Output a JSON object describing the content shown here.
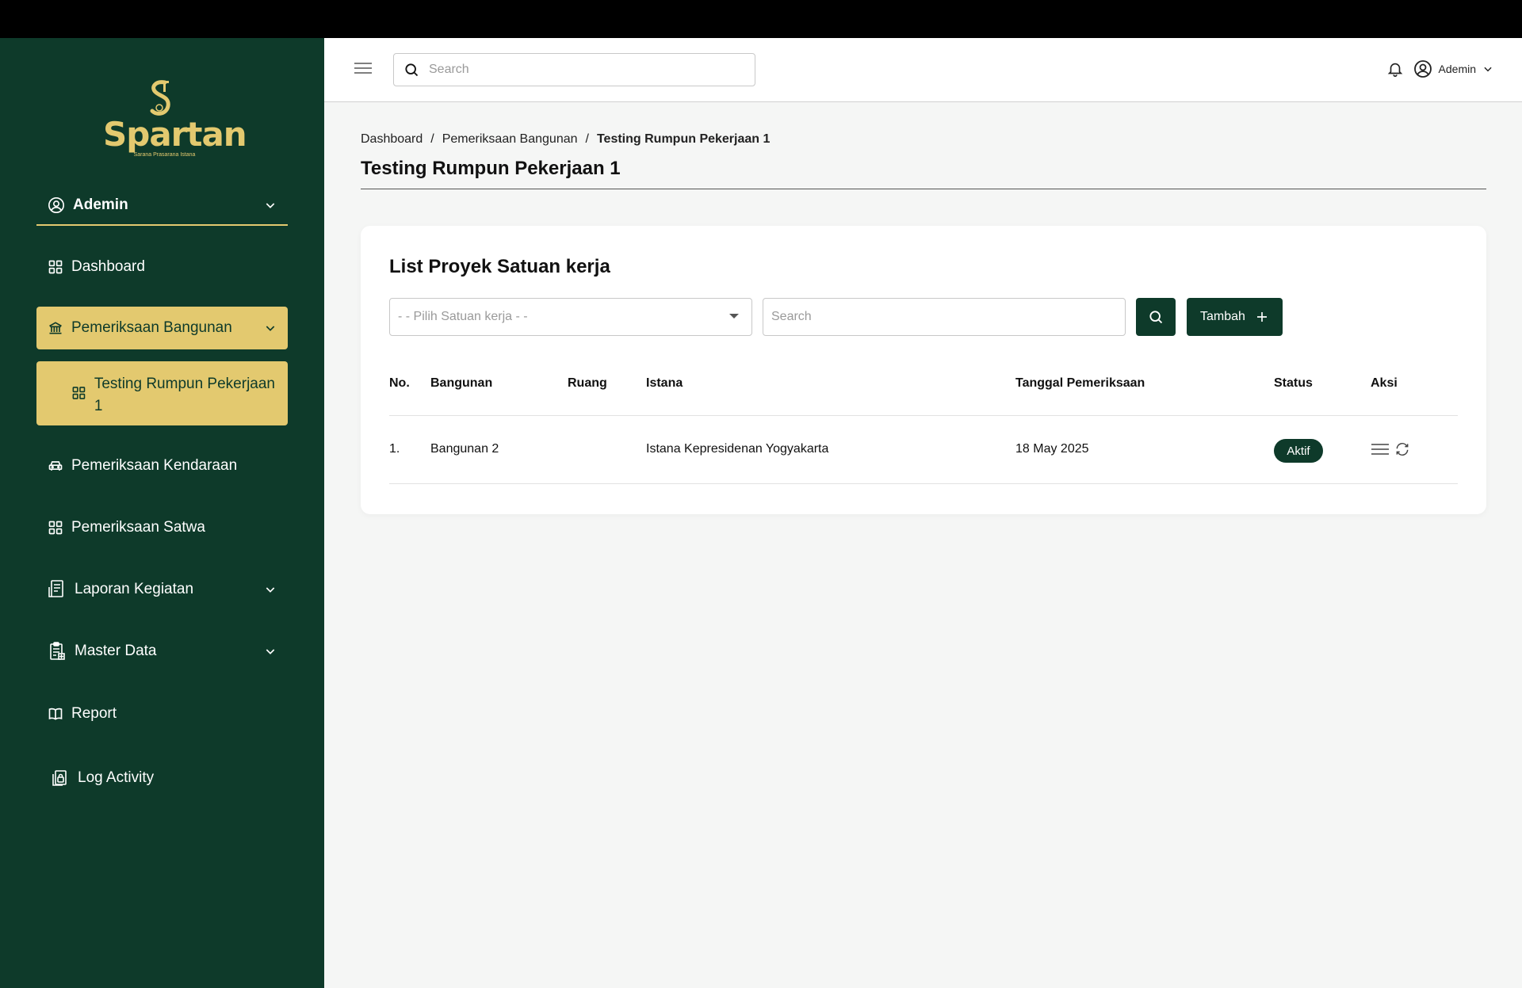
{
  "app": {
    "brand": "Spartan",
    "brand_sub": "Sarana Prasarana Istana"
  },
  "sidebar": {
    "user": "Ademin",
    "items": [
      {
        "label": "Dashboard",
        "icon": "grid-icon"
      },
      {
        "label": "Pemeriksaan Bangunan",
        "icon": "bank-icon",
        "active": true
      },
      {
        "label": "Testing Rumpun Pekerjaan 1",
        "icon": "grid-icon",
        "sub": true
      },
      {
        "label": "Pemeriksaan Kendaraan",
        "icon": "car-icon"
      },
      {
        "label": "Pemeriksaan Satwa",
        "icon": "grid-icon"
      },
      {
        "label": "Laporan Kegiatan",
        "icon": "report-icon"
      },
      {
        "label": "Master Data",
        "icon": "clipboard-icon"
      },
      {
        "label": "Report",
        "icon": "book-icon"
      },
      {
        "label": "Log Activity",
        "icon": "log-icon"
      }
    ]
  },
  "header": {
    "search_placeholder": "Search",
    "user": "Ademin"
  },
  "breadcrumb": [
    "Dashboard",
    "Pemeriksaan Bangunan",
    "Testing Rumpun Pekerjaan 1"
  ],
  "breadcrumb_sep": "/",
  "page_title": "Testing Rumpun Pekerjaan 1",
  "card": {
    "title": "List Proyek Satuan kerja",
    "select_placeholder": "- - Pilih Satuan kerja - -",
    "search_placeholder": "Search",
    "add_label": "Tambah",
    "columns": [
      "No.",
      "Bangunan",
      "Ruang",
      "Istana",
      "Tanggal Pemeriksaan",
      "Status",
      "Aksi"
    ],
    "rows": [
      {
        "no": "1.",
        "bangunan": "Bangunan 2",
        "ruang": "",
        "istana": "Istana Kepresidenan Yogyakarta",
        "tanggal": "18 May 2025",
        "status": "Aktif"
      }
    ]
  },
  "colors": {
    "sidebar_bg": "#0e3a2a",
    "accent_gold": "#e3c96f",
    "primary_button": "#0e3a2a"
  }
}
